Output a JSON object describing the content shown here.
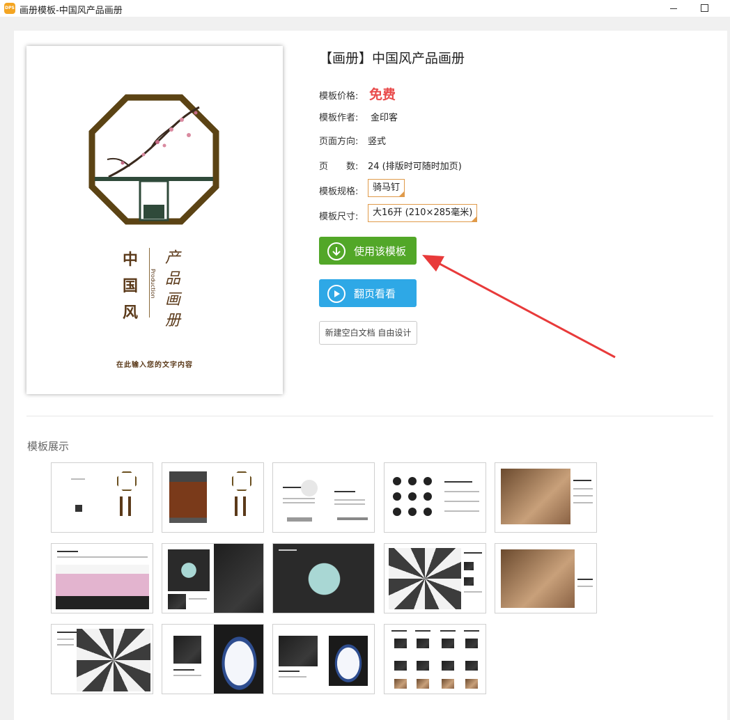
{
  "window": {
    "app_icon_text": "DPS",
    "title": "画册模板-中国风产品画册"
  },
  "cover": {
    "title_left": "中国风",
    "title_right": "产品画册",
    "subtitle": "Production",
    "tagline": "在此输入您的文字内容"
  },
  "info": {
    "title": "【画册】中国风产品画册",
    "price_label": "模板价格:",
    "price_value": "免费",
    "author_label": "模板作者:",
    "author_value": "金印客",
    "orientation_label": "页面方向:",
    "orientation_value": "竖式",
    "pages_label": "页　　数:",
    "pages_value": "24 (排版时可随时加页)",
    "spec_label": "模板规格:",
    "spec_value": "骑马钉",
    "size_label": "模板尺寸:",
    "size_value": "大16开 (210×285毫米)"
  },
  "buttons": {
    "use_template": "使用该模板",
    "flip_preview": "翻页看看",
    "new_blank": "新建空白文档 自由设计"
  },
  "showcase": {
    "title": "模板展示",
    "thumbnails": [
      {
        "name": "spread-1"
      },
      {
        "name": "spread-2"
      },
      {
        "name": "spread-3"
      },
      {
        "name": "spread-4"
      },
      {
        "name": "spread-5"
      },
      {
        "name": "spread-6"
      },
      {
        "name": "spread-7"
      },
      {
        "name": "spread-8"
      },
      {
        "name": "spread-9"
      },
      {
        "name": "spread-10"
      },
      {
        "name": "spread-11"
      },
      {
        "name": "spread-12"
      },
      {
        "name": "spread-13"
      },
      {
        "name": "spread-14"
      }
    ]
  },
  "colors": {
    "price": "#e94b4b",
    "use_button": "#52a728",
    "flip_button": "#2ea8e6",
    "box_border": "#e09a4a",
    "arrow": "#e83a3a"
  }
}
